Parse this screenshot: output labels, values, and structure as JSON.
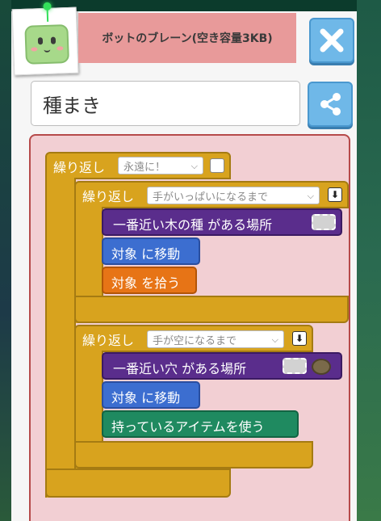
{
  "header": {
    "title": "ボットのブレーン(空き容量3KB)"
  },
  "bot_name": {
    "value": "種まき"
  },
  "blocks": {
    "outer_loop": {
      "label": "繰り返し",
      "dropdown": "永遠に！"
    },
    "inner_loop_1": {
      "label": "繰り返し",
      "dropdown": "手がいっぱいになるまで",
      "find_block": "一番近い木の種 がある場所",
      "move_block": "対象 に移動",
      "pickup_block": "対象 を拾う"
    },
    "inner_loop_2": {
      "label": "繰り返し",
      "dropdown": "手が空になるまで",
      "find_block": "一番近い穴 がある場所",
      "move_block": "対象 に移動",
      "use_block": "持っているアイテムを使う"
    }
  },
  "colors": {
    "title_bar": "#e89a9a",
    "workspace": "#f2cfd3",
    "loop": "#d8a31e",
    "find": "#5a2d8c",
    "move": "#3c6ed0",
    "pickup": "#e77416",
    "use": "#1f8a60",
    "button": "#6fb8e8"
  },
  "icons": {
    "close": "close-icon",
    "share": "share-icon",
    "avatar": "bot-avatar",
    "hole": "hole-icon",
    "down_arrow": "down-arrow-icon"
  }
}
